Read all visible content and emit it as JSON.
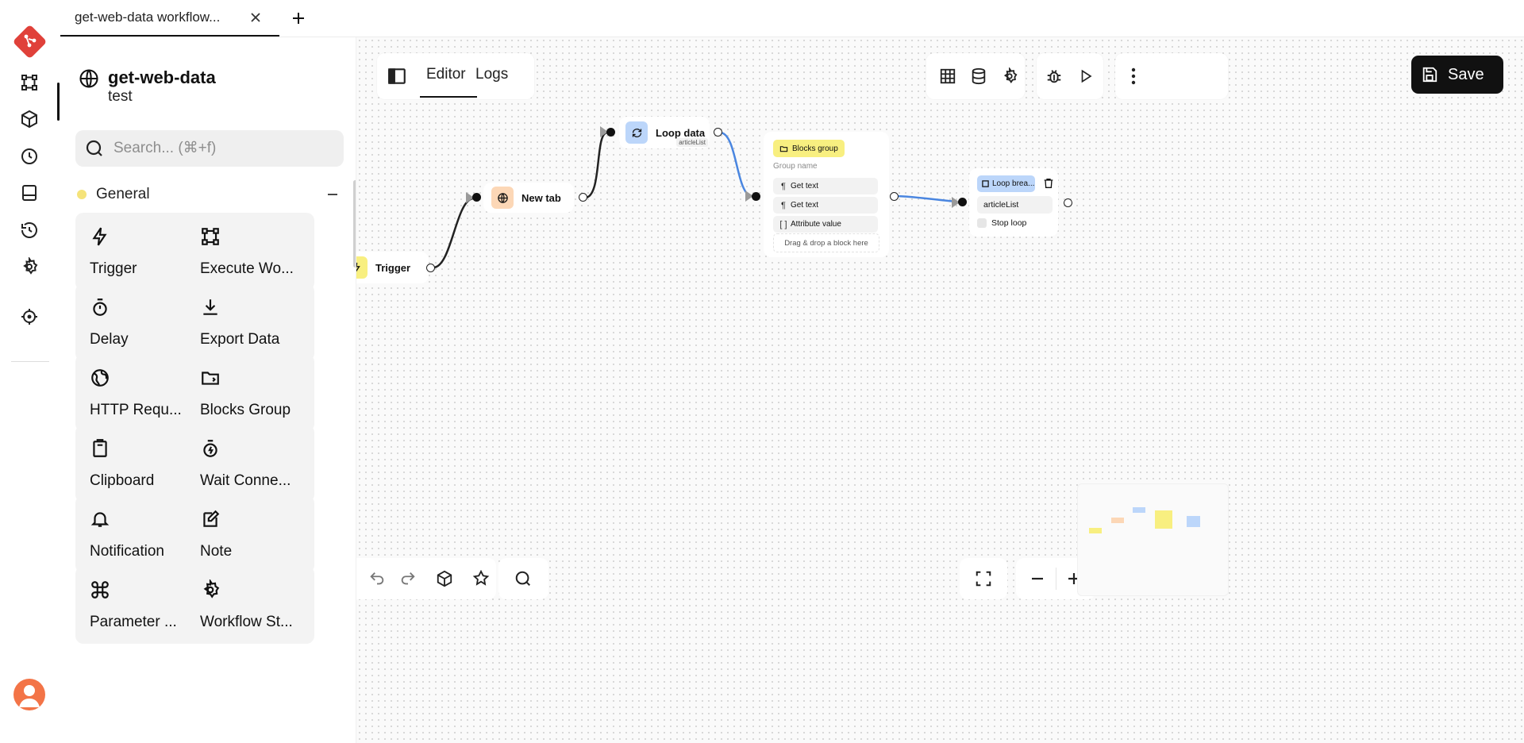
{
  "tab": {
    "title": "get-web-data workflow..."
  },
  "workflow": {
    "name": "get-web-data",
    "description": "test"
  },
  "search": {
    "placeholder": "Search... (⌘+f)"
  },
  "category": {
    "name": "General",
    "color": "#f5e37a"
  },
  "blocks": [
    {
      "label": "Trigger",
      "icon": "lightning-icon"
    },
    {
      "label": "Execute Wo...",
      "icon": "workflow-icon"
    },
    {
      "label": "Delay",
      "icon": "stopwatch-icon"
    },
    {
      "label": "Export Data",
      "icon": "download-icon"
    },
    {
      "label": "HTTP Requ...",
      "icon": "globe-icon"
    },
    {
      "label": "Blocks Group",
      "icon": "folder-icon"
    },
    {
      "label": "Clipboard",
      "icon": "clipboard-icon"
    },
    {
      "label": "Wait Conne...",
      "icon": "timer-icon"
    },
    {
      "label": "Notification",
      "icon": "bell-icon"
    },
    {
      "label": "Note",
      "icon": "note-icon"
    },
    {
      "label": "Parameter ...",
      "icon": "command-icon"
    },
    {
      "label": "Workflow St...",
      "icon": "gear-icon"
    }
  ],
  "editor": {
    "tab_editor": "Editor",
    "tab_logs": "Logs",
    "save_label": "Save"
  },
  "nodes": {
    "trigger": {
      "label": "Trigger",
      "color": "#f8ef80"
    },
    "new_tab": {
      "label": "New tab",
      "color": "#fcd7b6"
    },
    "loop_data": {
      "label": "Loop data",
      "tag": "articleList",
      "color": "#bcd6fa"
    },
    "blocks_group": {
      "badge": "Blocks group",
      "name_placeholder": "Group name",
      "items": [
        {
          "icon": "¶",
          "label": "Get text"
        },
        {
          "icon": "¶",
          "label": "Get text"
        },
        {
          "icon": "[ ]",
          "label": "Attribute value"
        }
      ],
      "drop_hint": "Drag & drop a block here"
    },
    "loop_breakpoint": {
      "badge": "Loop brea...",
      "input": "articleList",
      "checkbox": "Stop loop"
    }
  },
  "colors": {
    "accent": "#111111",
    "edge_default": "#222222",
    "edge_active": "#4a86e0",
    "brand": "#e0413a"
  }
}
